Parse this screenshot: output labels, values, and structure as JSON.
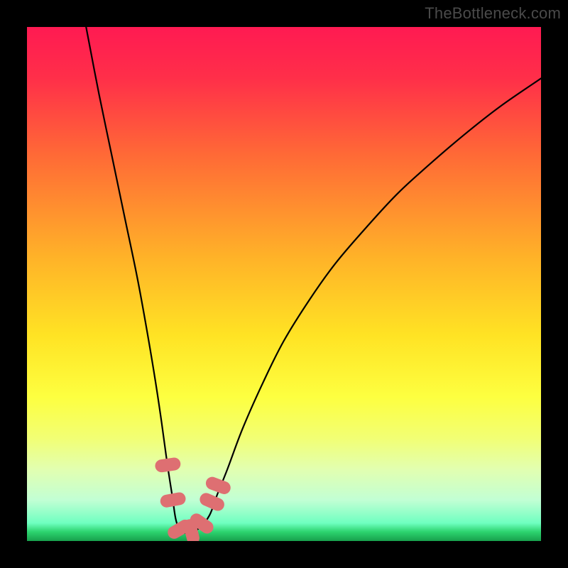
{
  "watermark": "TheBottleneck.com",
  "chart_data": {
    "type": "line",
    "title": "",
    "xlabel": "",
    "ylabel": "",
    "xlim": [
      0,
      100
    ],
    "ylim": [
      0,
      100
    ],
    "gradient_stops": [
      {
        "offset": 0.0,
        "color": "#ff1a52"
      },
      {
        "offset": 0.1,
        "color": "#ff2f49"
      },
      {
        "offset": 0.25,
        "color": "#ff6a36"
      },
      {
        "offset": 0.45,
        "color": "#ffb328"
      },
      {
        "offset": 0.6,
        "color": "#ffe324"
      },
      {
        "offset": 0.72,
        "color": "#fdff40"
      },
      {
        "offset": 0.8,
        "color": "#f2ff74"
      },
      {
        "offset": 0.86,
        "color": "#e2ffb0"
      },
      {
        "offset": 0.92,
        "color": "#c2ffd4"
      },
      {
        "offset": 0.965,
        "color": "#6fffc0"
      },
      {
        "offset": 0.982,
        "color": "#2dd46f"
      },
      {
        "offset": 1.0,
        "color": "#17a04c"
      }
    ],
    "series": [
      {
        "name": "bottleneck-curve",
        "x": [
          11.5,
          14,
          16.5,
          19,
          21.5,
          23.5,
          25,
          26.2,
          27.3,
          28.3,
          29,
          30,
          31.5,
          33.5,
          35.5,
          37,
          39,
          42,
          46,
          50,
          55,
          60,
          66,
          72,
          78,
          85,
          92,
          100
        ],
        "y": [
          100,
          87,
          75,
          63,
          51,
          40,
          31,
          23,
          15,
          8.5,
          4.0,
          1.8,
          1.7,
          2.5,
          5.0,
          9,
          14,
          22,
          31,
          39,
          47,
          54,
          61,
          67.5,
          73,
          79,
          84.5,
          90
        ]
      }
    ],
    "markers": [
      {
        "x": 27.4,
        "y": 14.8,
        "color": "#de6f72"
      },
      {
        "x": 28.4,
        "y": 8.0,
        "color": "#de6f72"
      },
      {
        "x": 29.7,
        "y": 2.3,
        "color": "#de6f72"
      },
      {
        "x": 32.0,
        "y": 1.8,
        "color": "#de6f72"
      },
      {
        "x": 34.0,
        "y": 3.4,
        "color": "#de6f72"
      },
      {
        "x": 36.0,
        "y": 7.6,
        "color": "#de6f72"
      },
      {
        "x": 37.2,
        "y": 10.8,
        "color": "#de6f72"
      }
    ]
  }
}
